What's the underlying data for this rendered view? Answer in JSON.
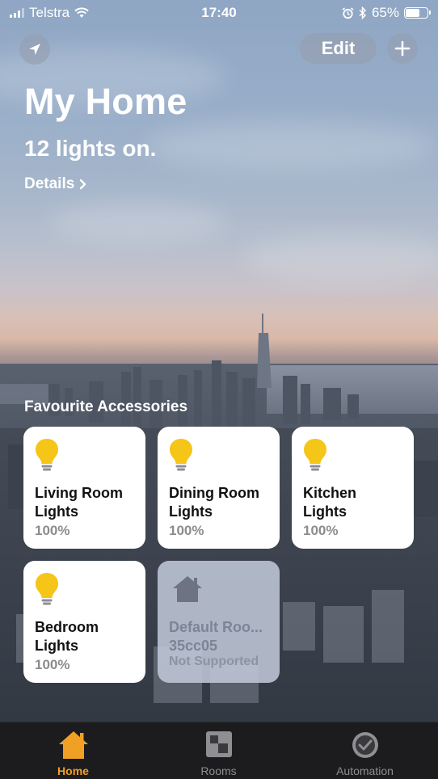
{
  "status_bar": {
    "carrier": "Telstra",
    "time": "17:40",
    "battery": "65%",
    "battery_level": 0.65
  },
  "header": {
    "edit_label": "Edit",
    "title": "My Home",
    "subtitle": "12 lights on.",
    "details_label": "Details"
  },
  "favourites": {
    "title": "Favourite Accessories",
    "tiles": [
      {
        "name_line1": "Living Room",
        "name_line2": "Lights",
        "state": "100%",
        "icon": "lightbulb-icon"
      },
      {
        "name_line1": "Dining Room",
        "name_line2": "Lights",
        "state": "100%",
        "icon": "lightbulb-icon"
      },
      {
        "name_line1": "Kitchen",
        "name_line2": "Lights",
        "state": "100%",
        "icon": "lightbulb-icon"
      },
      {
        "name_line1": "Bedroom",
        "name_line2": "Lights",
        "state": "100%",
        "icon": "lightbulb-icon"
      },
      {
        "name_line1": "Default Roo...",
        "name_line2": "35cc05",
        "state": "Not Supported",
        "icon": "house-icon"
      }
    ]
  },
  "tab_bar": {
    "tabs": [
      {
        "label": "Home",
        "icon": "home-icon",
        "active": true
      },
      {
        "label": "Rooms",
        "icon": "rooms-icon",
        "active": false
      },
      {
        "label": "Automation",
        "icon": "automation-icon",
        "active": false
      }
    ]
  },
  "colors": {
    "accent": "#f0a125",
    "bulb": "#f5c518",
    "tile_bg": "#ffffff",
    "tab_bar_bg": "#1c1c1e"
  }
}
